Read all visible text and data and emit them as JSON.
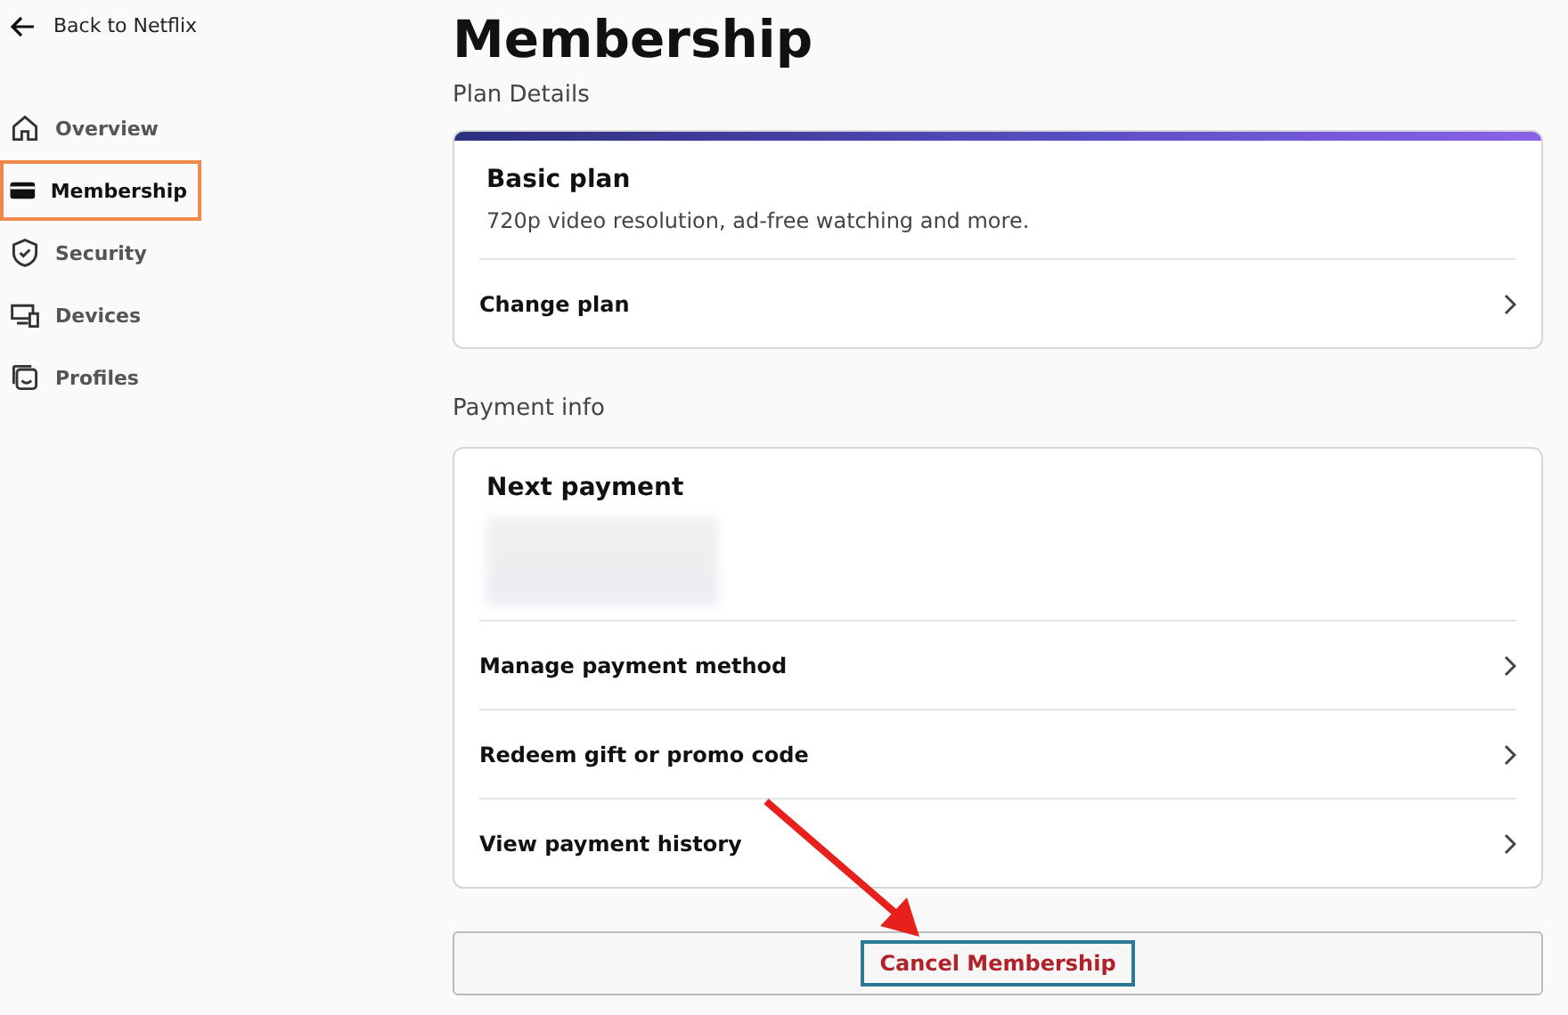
{
  "back_link": "Back to Netflix",
  "nav": [
    {
      "label": "Overview",
      "selected": false
    },
    {
      "label": "Membership",
      "selected": true
    },
    {
      "label": "Security",
      "selected": false
    },
    {
      "label": "Devices",
      "selected": false
    },
    {
      "label": "Profiles",
      "selected": false
    }
  ],
  "title": "Membership",
  "plan_section": {
    "label": "Plan Details",
    "plan": "Basic plan",
    "description": "720p video resolution, ad-free watching and more.",
    "action": "Change plan"
  },
  "payment_section": {
    "label": "Payment info",
    "heading": "Next payment",
    "rows": [
      "Manage payment method",
      "Redeem gift or promo code",
      "View payment history"
    ]
  },
  "cancel_button": "Cancel Membership"
}
